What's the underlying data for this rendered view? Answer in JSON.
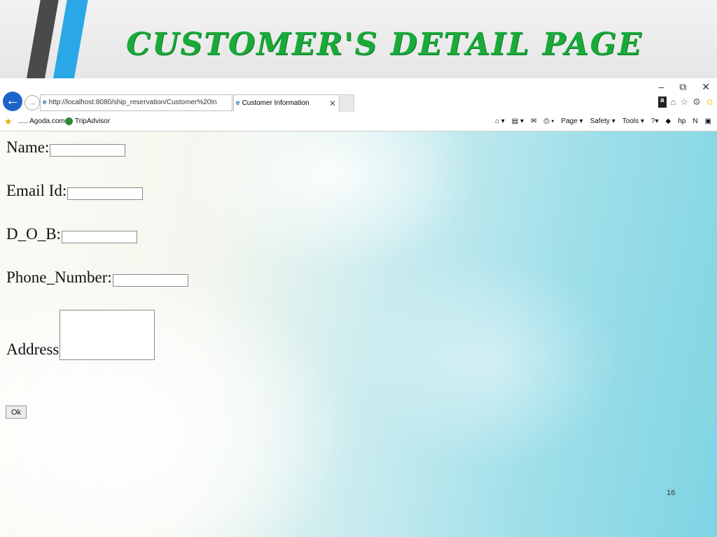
{
  "slide": {
    "title": "CUSTOMER'S DETAIL PAGE",
    "page_number": "16"
  },
  "window_controls": [
    "–",
    "⧉",
    "✕"
  ],
  "browser": {
    "address_url": "http://localhost:8080/ship_reservation/Customer%20In",
    "tab_title": "Customer Information",
    "tab_close": "✕"
  },
  "favorites": {
    "items": [
      "Agoda.com",
      "TripAdvisor"
    ],
    "prefix": "....."
  },
  "command_bar": {
    "items": [
      "Page ▾",
      "Safety ▾",
      "Tools ▾"
    ]
  },
  "form": {
    "name_label": "Name:",
    "email_label": "Email Id:",
    "dob_label": "D_O_B:",
    "phone_label": "Phone_Number:",
    "address_label": "Address",
    "ok_label": "Ok"
  },
  "colors": {
    "title_green": "#1aaa3a",
    "back_button_blue": "#1e64c8",
    "stripe_blue": "#2aa7e6",
    "stripe_dark": "#4a4a4a"
  }
}
